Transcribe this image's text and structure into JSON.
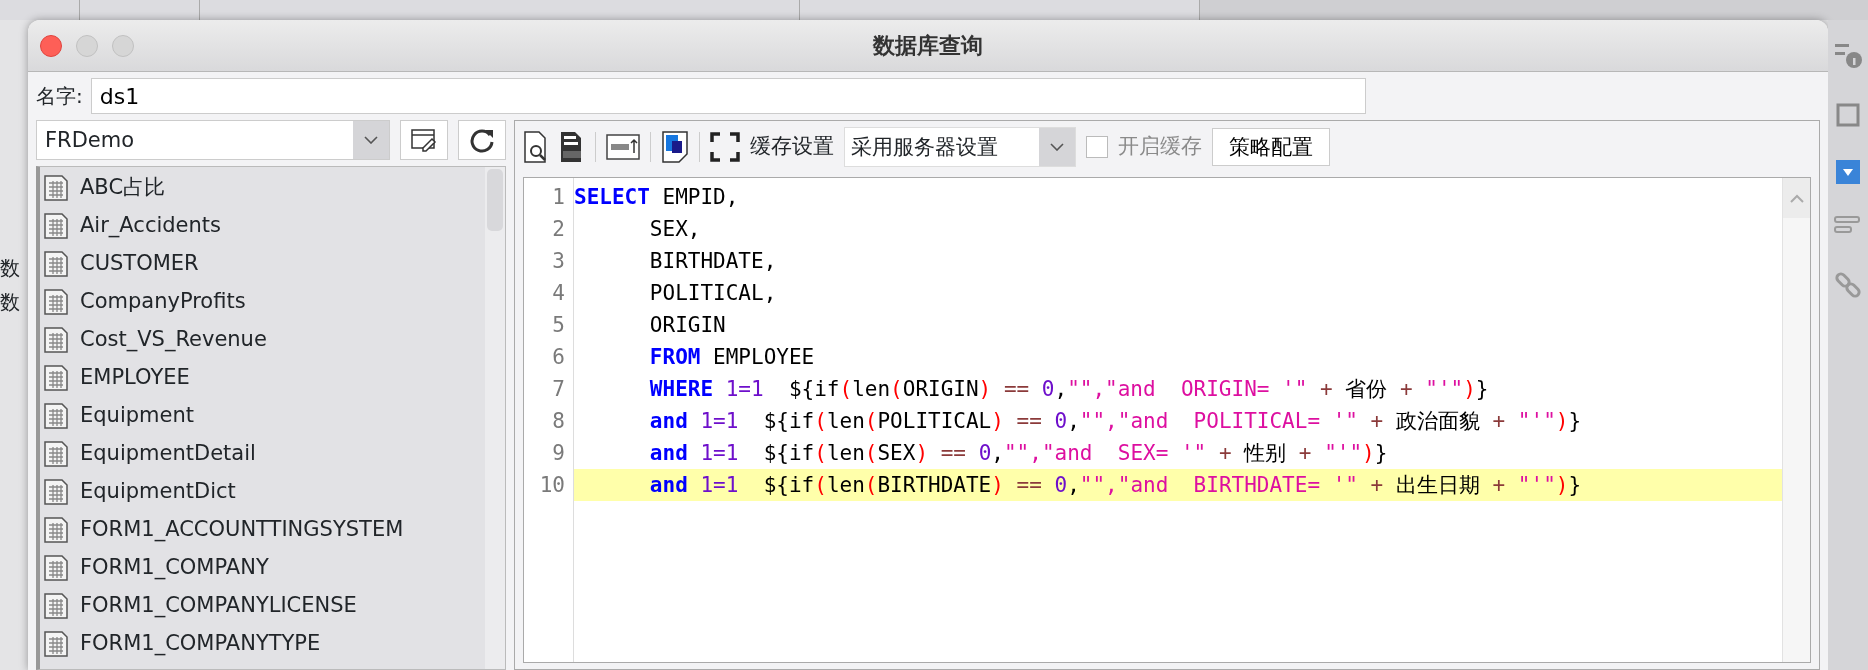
{
  "background": {
    "side_labels": [
      "数",
      "数"
    ]
  },
  "window": {
    "title": "数据库查询"
  },
  "name_field": {
    "label": "名字:",
    "value": "ds1"
  },
  "datasource": {
    "value": "FRDemo"
  },
  "tables": [
    {
      "name": "ABC占比"
    },
    {
      "name": "Air_Accidents"
    },
    {
      "name": "CUSTOMER"
    },
    {
      "name": "CompanyProfits"
    },
    {
      "name": "Cost_VS_Revenue"
    },
    {
      "name": "EMPLOYEE"
    },
    {
      "name": "Equipment"
    },
    {
      "name": "EquipmentDetail"
    },
    {
      "name": "EquipmentDict"
    },
    {
      "name": "FORM1_ACCOUNTTINGSYSTEM"
    },
    {
      "name": "FORM1_COMPANY"
    },
    {
      "name": "FORM1_COMPANYLICENSE"
    },
    {
      "name": "FORM1_COMPANYTYPE"
    }
  ],
  "toolbar": {
    "cache_label": "缓存设置",
    "cache_select": "采用服务器设置",
    "enable_cache": {
      "label": "开启缓存",
      "checked": false,
      "disabled": true
    },
    "policy_button": "策略配置"
  },
  "code": [
    {
      "number": "1",
      "current": false,
      "indented": false,
      "tokens": [
        {
          "kind": "kw",
          "text": "SELECT"
        },
        {
          "kind": "plain",
          "text": " EMPID,"
        }
      ]
    },
    {
      "number": "2",
      "current": false,
      "indented": true,
      "tokens": [
        {
          "kind": "plain",
          "text": "SEX,"
        }
      ]
    },
    {
      "number": "3",
      "current": false,
      "indented": true,
      "tokens": [
        {
          "kind": "plain",
          "text": "BIRTHDATE,"
        }
      ]
    },
    {
      "number": "4",
      "current": false,
      "indented": true,
      "tokens": [
        {
          "kind": "plain",
          "text": "POLITICAL,"
        }
      ]
    },
    {
      "number": "5",
      "current": false,
      "indented": true,
      "tokens": [
        {
          "kind": "plain",
          "text": "ORIGIN"
        }
      ]
    },
    {
      "number": "6",
      "current": false,
      "indented": true,
      "tokens": [
        {
          "kind": "kw",
          "text": "FROM"
        },
        {
          "kind": "plain",
          "text": " EMPLOYEE"
        }
      ]
    },
    {
      "number": "7",
      "current": false,
      "indented": true,
      "tokens": [
        {
          "kind": "kw",
          "text": "WHERE"
        },
        {
          "kind": "num",
          "text": " 1=1"
        },
        {
          "kind": "plain",
          "text": "  ${if"
        },
        {
          "kind": "paren",
          "text": "("
        },
        {
          "kind": "plain",
          "text": "len"
        },
        {
          "kind": "paren",
          "text": "("
        },
        {
          "kind": "plain",
          "text": "ORIGIN"
        },
        {
          "kind": "paren",
          "text": ")"
        },
        {
          "kind": "op",
          "text": " == "
        },
        {
          "kind": "num",
          "text": "0"
        },
        {
          "kind": "plain",
          "text": ","
        },
        {
          "kind": "str",
          "text": "\"\",\"and  ORIGIN= '\""
        },
        {
          "kind": "op",
          "text": " + "
        },
        {
          "kind": "plain",
          "text": "省份"
        },
        {
          "kind": "op",
          "text": " + "
        },
        {
          "kind": "str",
          "text": "\"'\""
        },
        {
          "kind": "paren",
          "text": ")"
        },
        {
          "kind": "plain",
          "text": "}"
        }
      ]
    },
    {
      "number": "8",
      "current": false,
      "indented": true,
      "tokens": [
        {
          "kind": "kw",
          "text": "and"
        },
        {
          "kind": "num",
          "text": " 1=1"
        },
        {
          "kind": "plain",
          "text": "  ${if"
        },
        {
          "kind": "paren",
          "text": "("
        },
        {
          "kind": "plain",
          "text": "len"
        },
        {
          "kind": "paren",
          "text": "("
        },
        {
          "kind": "plain",
          "text": "POLITICAL"
        },
        {
          "kind": "paren",
          "text": ")"
        },
        {
          "kind": "op",
          "text": " == "
        },
        {
          "kind": "num",
          "text": "0"
        },
        {
          "kind": "plain",
          "text": ","
        },
        {
          "kind": "str",
          "text": "\"\",\"and  POLITICAL= '\""
        },
        {
          "kind": "op",
          "text": " + "
        },
        {
          "kind": "plain",
          "text": "政治面貌"
        },
        {
          "kind": "op",
          "text": " + "
        },
        {
          "kind": "str",
          "text": "\"'\""
        },
        {
          "kind": "paren",
          "text": ")"
        },
        {
          "kind": "plain",
          "text": "}"
        }
      ]
    },
    {
      "number": "9",
      "current": false,
      "indented": true,
      "tokens": [
        {
          "kind": "kw",
          "text": "and"
        },
        {
          "kind": "num",
          "text": " 1=1"
        },
        {
          "kind": "plain",
          "text": "  ${if"
        },
        {
          "kind": "paren",
          "text": "("
        },
        {
          "kind": "plain",
          "text": "len"
        },
        {
          "kind": "paren",
          "text": "("
        },
        {
          "kind": "plain",
          "text": "SEX"
        },
        {
          "kind": "paren",
          "text": ")"
        },
        {
          "kind": "op",
          "text": " == "
        },
        {
          "kind": "num",
          "text": "0"
        },
        {
          "kind": "plain",
          "text": ","
        },
        {
          "kind": "str",
          "text": "\"\",\"and  SEX= '\""
        },
        {
          "kind": "op",
          "text": " + "
        },
        {
          "kind": "plain",
          "text": "性别"
        },
        {
          "kind": "op",
          "text": " + "
        },
        {
          "kind": "str",
          "text": "\"'\""
        },
        {
          "kind": "paren",
          "text": ")"
        },
        {
          "kind": "plain",
          "text": "}"
        }
      ]
    },
    {
      "number": "10",
      "current": true,
      "indented": true,
      "tokens": [
        {
          "kind": "kw",
          "text": "and"
        },
        {
          "kind": "num",
          "text": " 1=1"
        },
        {
          "kind": "plain",
          "text": "  ${if"
        },
        {
          "kind": "paren",
          "text": "("
        },
        {
          "kind": "plain",
          "text": "len"
        },
        {
          "kind": "paren",
          "text": "("
        },
        {
          "kind": "plain",
          "text": "BIRTHDATE"
        },
        {
          "kind": "paren",
          "text": ")"
        },
        {
          "kind": "op",
          "text": " == "
        },
        {
          "kind": "num",
          "text": "0"
        },
        {
          "kind": "plain",
          "text": ","
        },
        {
          "kind": "str",
          "text": "\"\",\"and  BIRTHDATE= '\""
        },
        {
          "kind": "op",
          "text": " + "
        },
        {
          "kind": "plain",
          "text": "出生日期"
        },
        {
          "kind": "op",
          "text": " + "
        },
        {
          "kind": "str",
          "text": "\"'\""
        },
        {
          "kind": "paren",
          "text": ")"
        },
        {
          "kind": "plain",
          "text": "}"
        }
      ]
    }
  ]
}
